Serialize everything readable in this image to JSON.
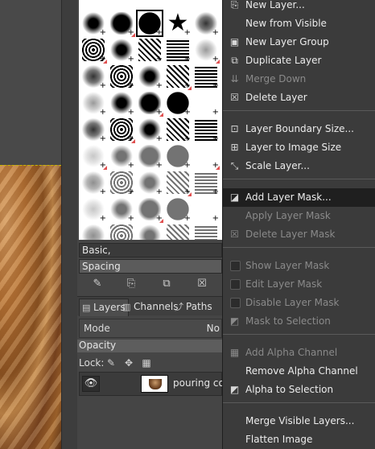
{
  "canvas": {
    "image_description_icon": "coffee-photo"
  },
  "brushes": {
    "name_field": "Basic,",
    "spacing_label": "Spacing",
    "actions": [
      {
        "icon": "edit-brush-icon",
        "glyph": "✎"
      },
      {
        "icon": "new-brush-icon",
        "glyph": "⎘"
      },
      {
        "icon": "duplicate-brush-icon",
        "glyph": "⧉"
      },
      {
        "icon": "delete-brush-icon",
        "glyph": "☒"
      }
    ]
  },
  "tabs": [
    {
      "label": "Layers",
      "icon": "layers-icon",
      "active": true
    },
    {
      "label": "Channels",
      "icon": "channels-icon",
      "active": false
    },
    {
      "label": "Paths",
      "icon": "paths-icon",
      "active": false
    }
  ],
  "layers_panel": {
    "mode_label": "Mode",
    "mode_value": "No",
    "opacity_label": "Opacity",
    "lock_label": "Lock:",
    "layer_name": "pouring coffe"
  },
  "menu": {
    "items": [
      {
        "label": "New Layer...",
        "icon": "new-layer-icon",
        "glyph": "⎘",
        "disabled": false
      },
      {
        "label": "New from Visible",
        "icon": "",
        "glyph": "",
        "disabled": false
      },
      {
        "label": "New Layer Group",
        "icon": "new-group-icon",
        "glyph": "▣",
        "disabled": false
      },
      {
        "label": "Duplicate Layer",
        "icon": "duplicate-icon",
        "glyph": "⧉",
        "disabled": false
      },
      {
        "label": "Merge Down",
        "icon": "merge-down-icon",
        "glyph": "⇊",
        "disabled": true
      },
      {
        "label": "Delete Layer",
        "icon": "delete-icon",
        "glyph": "☒",
        "disabled": false
      },
      {
        "label": "Layer Boundary Size...",
        "icon": "boundary-size-icon",
        "glyph": "⊡",
        "disabled": false
      },
      {
        "label": "Layer to Image Size",
        "icon": "to-image-size-icon",
        "glyph": "⊞",
        "disabled": false
      },
      {
        "label": "Scale Layer...",
        "icon": "scale-icon",
        "glyph": "⤡",
        "disabled": false
      },
      {
        "label": "Add Layer Mask...",
        "icon": "add-mask-icon",
        "glyph": "◪",
        "disabled": false,
        "highlighted": true
      },
      {
        "label": "Apply Layer Mask",
        "icon": "",
        "glyph": "",
        "disabled": true
      },
      {
        "label": "Delete Layer Mask",
        "icon": "delete-mask-icon",
        "glyph": "☒",
        "disabled": true
      },
      {
        "label": "Show Layer Mask",
        "icon": "checkbox",
        "glyph": "",
        "disabled": true,
        "checkbox": true
      },
      {
        "label": "Edit Layer Mask",
        "icon": "checkbox",
        "glyph": "",
        "disabled": true,
        "checkbox": true
      },
      {
        "label": "Disable Layer Mask",
        "icon": "checkbox",
        "glyph": "",
        "disabled": true,
        "checkbox": true
      },
      {
        "label": "Mask to Selection",
        "icon": "mask-selection-icon",
        "glyph": "◩",
        "disabled": true
      },
      {
        "label": "Add Alpha Channel",
        "icon": "alpha-channel-icon",
        "glyph": "▦",
        "disabled": true
      },
      {
        "label": "Remove Alpha Channel",
        "icon": "",
        "glyph": "",
        "disabled": false
      },
      {
        "label": "Alpha to Selection",
        "icon": "alpha-selection-icon",
        "glyph": "◩",
        "disabled": false
      },
      {
        "label": "Merge Visible Layers...",
        "icon": "",
        "glyph": "",
        "disabled": false
      },
      {
        "label": "Flatten Image",
        "icon": "",
        "glyph": "",
        "disabled": false
      }
    ]
  }
}
